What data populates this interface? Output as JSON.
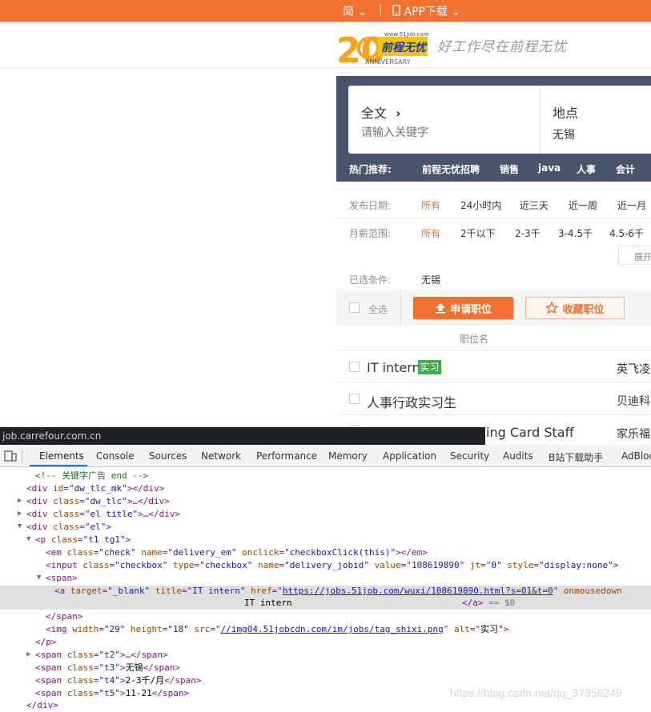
{
  "topbar": {
    "lang": "简",
    "lang_arrow": "⌄",
    "divider": "|",
    "app_label": "APP下载",
    "app_arrow": "⌄"
  },
  "logo": {
    "twenty": "20",
    "domain": "www.51job.com",
    "brand": "前程无忧",
    "anniversary": "ANNIVERSARY"
  },
  "slogan": "好工作尽在前程无忧",
  "search": {
    "type_label": "全文",
    "type_arrow": "›",
    "placeholder": "请输入关键字",
    "location_label": "地点",
    "location_value": "无锡",
    "hot_label": "热门推荐:",
    "hot_items": [
      "前程无忧招聘",
      "销售",
      "java",
      "人事",
      "会计"
    ]
  },
  "filters": {
    "date_label": "发布日期:",
    "date_options": [
      "所有",
      "24小时内",
      "近三天",
      "近一周",
      "近一月"
    ],
    "salary_label": "月薪范围:",
    "salary_options": [
      "所有",
      "2千以下",
      "2-3千",
      "3-4.5千",
      "4.5-6千"
    ],
    "expand": "展开"
  },
  "selected": {
    "label": "已选条件:",
    "value": "无锡"
  },
  "actions": {
    "select_all": "全选",
    "apply": "申请职位",
    "favorite": "收藏职位"
  },
  "list": {
    "header": "职位名",
    "rows": [
      {
        "title": "IT intern",
        "tag": "实习",
        "company": "英飞凌"
      },
      {
        "title": "人事行政实习生",
        "company": "贝迪科"
      },
      {
        "title": "ing Card Staff",
        "company": "家乐福"
      }
    ]
  },
  "devtools": {
    "url_tip": "job.carrefour.com.cn",
    "tabs": [
      "Elements",
      "Console",
      "Sources",
      "Network",
      "Performance",
      "Memory",
      "Application",
      "Security",
      "Audits",
      "B站下载助手",
      "AdBloc"
    ],
    "lines": {
      "l1": "<!-- 关键字广告 end -->",
      "l2a": "<div ",
      "l2n": "id",
      "l2v": "\"dw_tlc_mk\"",
      "l2b": "></div>",
      "l3a": "<div ",
      "l3n": "class",
      "l3v": "\"dw_tlc\"",
      "l3b": ">…</div>",
      "l4a": "<div ",
      "l4n": "class",
      "l4v": "\"el title\"",
      "l4b": ">…</div>",
      "l5a": "<div ",
      "l5n": "class",
      "l5v": "\"el\"",
      "l5b": ">",
      "l6a": "<p ",
      "l6n": "class",
      "l6v": "\"t1 tg1\"",
      "l6b": ">",
      "l7a": "<em ",
      "l7n1": "class",
      "l7v1": "\"check\"",
      "l7n2": "name",
      "l7v2": "\"delivery_em\"",
      "l7n3": "onclick",
      "l7v3": "\"checkboxClick(this)\"",
      "l7b": "></em>",
      "l8a": "<input ",
      "l8n1": "class",
      "l8v1": "\"checkbox\"",
      "l8n2": "type",
      "l8v2": "\"checkbox\"",
      "l8n3": "name",
      "l8v3": "\"delivery_jobid\"",
      "l8n4": "value",
      "l8v4": "\"108619890\"",
      "l8n5": "jt",
      "l8v5": "\"0\"",
      "l8n6": "style",
      "l8v6": "\"display:none\"",
      "l8b": ">",
      "l9": "<span>",
      "l10a": "<a ",
      "l10n1": "target",
      "l10v1": "\"_blank\"",
      "l10n2": "title",
      "l10v2": "\"IT intern\"",
      "l10n3": "href",
      "l10v3": "https://jobs.51job.com/wuxi/108619890.html?s=01&t=0",
      "l10n4": "onmousedown",
      "l11t": "IT intern",
      "l11c": "</a>",
      "l11d": "== $0",
      "l12": "</span>",
      "l13a": "<img ",
      "l13n1": "width",
      "l13v1": "\"29\"",
      "l13n2": "height",
      "l13v2": "\"18\"",
      "l13n3": "src",
      "l13v3": "//img04.51jobcdn.com/im/jobs/tag_shixi.png",
      "l13n4": "alt",
      "l13v4": "实习",
      "l13b": ">",
      "l14": "</p>",
      "l15a": "<span ",
      "l15n": "class",
      "l15v": "\"t2\"",
      "l15b": ">…</span>",
      "l16a": "<span ",
      "l16n": "class",
      "l16v": "\"t3\"",
      "l16t": "无锡",
      "l16b": "</span>",
      "l17a": "<span ",
      "l17n": "class",
      "l17v": "\"t4\"",
      "l17t": "2-3千/月",
      "l17b": "</span>",
      "l18a": "<span ",
      "l18n": "class",
      "l18v": "\"t5\"",
      "l18t": "11-21",
      "l18b": "</span>",
      "l19": "</div>"
    }
  },
  "watermark": "https://blog.csdn.net/qq_37356249",
  "colors": {
    "brand": "#f27130",
    "search_bg": "#49536a",
    "devtools_bg": "#f3f3f3"
  }
}
